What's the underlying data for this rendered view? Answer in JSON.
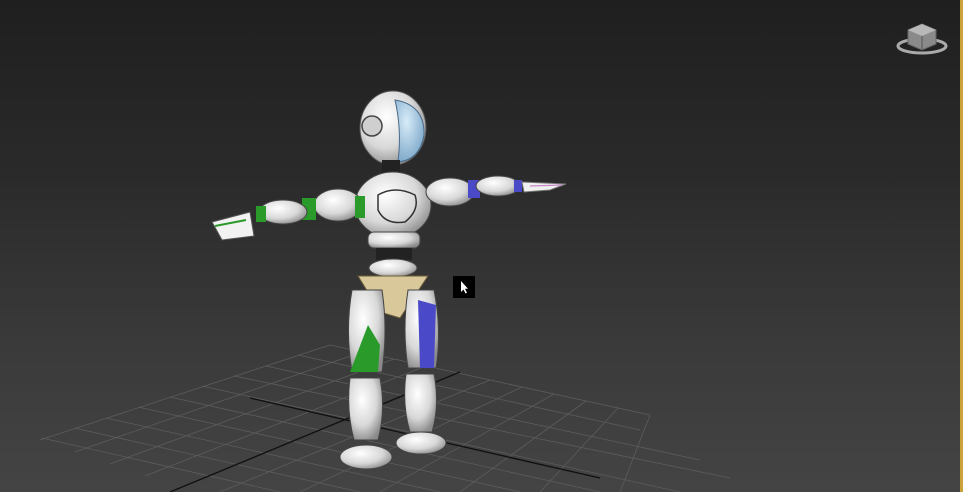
{
  "viewport": {
    "background_top": "#1f1f1f",
    "background_bottom": "#444444",
    "active_border_color": "#caa23a",
    "grid_color": "#5a5a5a",
    "grid_axis_color": "#111111"
  },
  "model": {
    "body_color": "#e8e8e8",
    "left_side_color": "#2a9a2a",
    "right_side_color": "#4a4ac8",
    "pelvis_color": "#d8c89a",
    "visor_color": "#9cc8e8"
  },
  "icons": {
    "viewcube": "viewcube-icon",
    "cursor": "cursor-arrow-icon"
  }
}
